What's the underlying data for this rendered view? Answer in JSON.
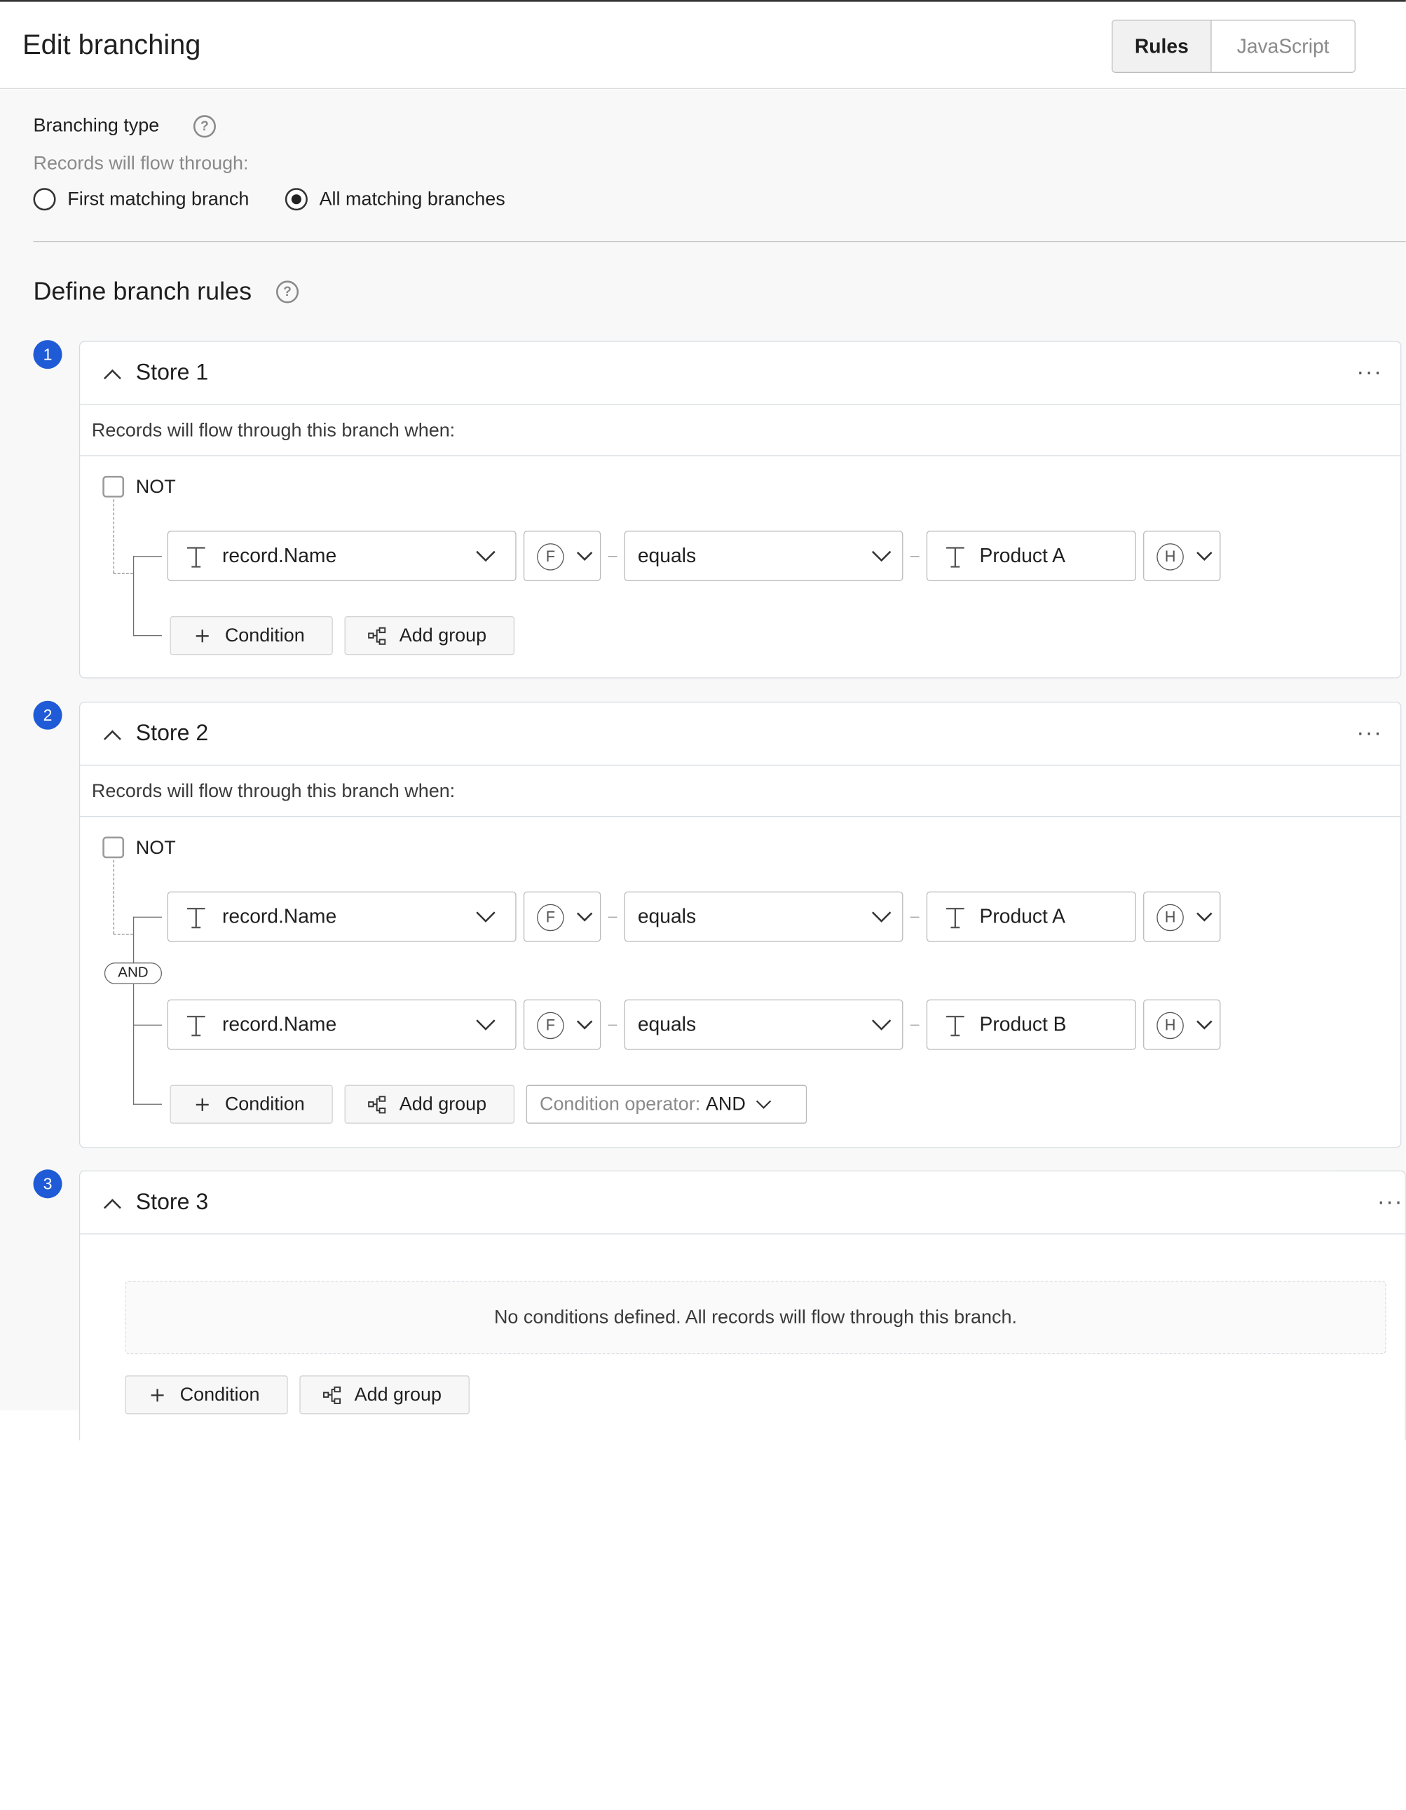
{
  "header": {
    "title": "Edit branching",
    "tabs": [
      {
        "label": "Rules",
        "active": true
      },
      {
        "label": "JavaScript",
        "active": false
      }
    ]
  },
  "branching": {
    "label": "Branching type",
    "hint": "Records will flow through:",
    "options": [
      {
        "label": "First matching branch",
        "checked": false
      },
      {
        "label": "All matching branches",
        "checked": true
      }
    ]
  },
  "rules_title": "Define branch rules",
  "help_glyph": "?",
  "branches": [
    {
      "number": "1",
      "title": "Store 1",
      "more": "···",
      "desc": "Records will flow through this branch when:",
      "not_label": "NOT",
      "conditions": [
        {
          "field": "record.Name",
          "fn": "F",
          "operator": "equals",
          "value": "Product A",
          "hx": "H"
        }
      ],
      "buttons": {
        "condition": "Condition",
        "add_group": "Add group"
      }
    },
    {
      "number": "2",
      "title": "Store 2",
      "more": "···",
      "desc": "Records will flow through this branch when:",
      "not_label": "NOT",
      "joiner": "AND",
      "conditions": [
        {
          "field": "record.Name",
          "fn": "F",
          "operator": "equals",
          "value": "Product A",
          "hx": "H"
        },
        {
          "field": "record.Name",
          "fn": "F",
          "operator": "equals",
          "value": "Product B",
          "hx": "H"
        }
      ],
      "buttons": {
        "condition": "Condition",
        "add_group": "Add group"
      },
      "operator_select": {
        "label": "Condition operator:",
        "value": "AND"
      }
    },
    {
      "number": "3",
      "title": "Store 3",
      "more": "···",
      "empty": "No conditions defined. All records will flow through this branch.",
      "buttons": {
        "condition": "Condition",
        "add_group": "Add group"
      }
    }
  ],
  "icons": {
    "text_type": "text-type-icon",
    "function": "function-icon",
    "hash": "hash-icon",
    "plus": "plus-icon",
    "group": "add-group-icon",
    "chevron": "chevron-down-icon"
  },
  "colors": {
    "accent": "#1f5bd6",
    "border": "#d6dbe0",
    "muted": "#8a8a8a"
  }
}
